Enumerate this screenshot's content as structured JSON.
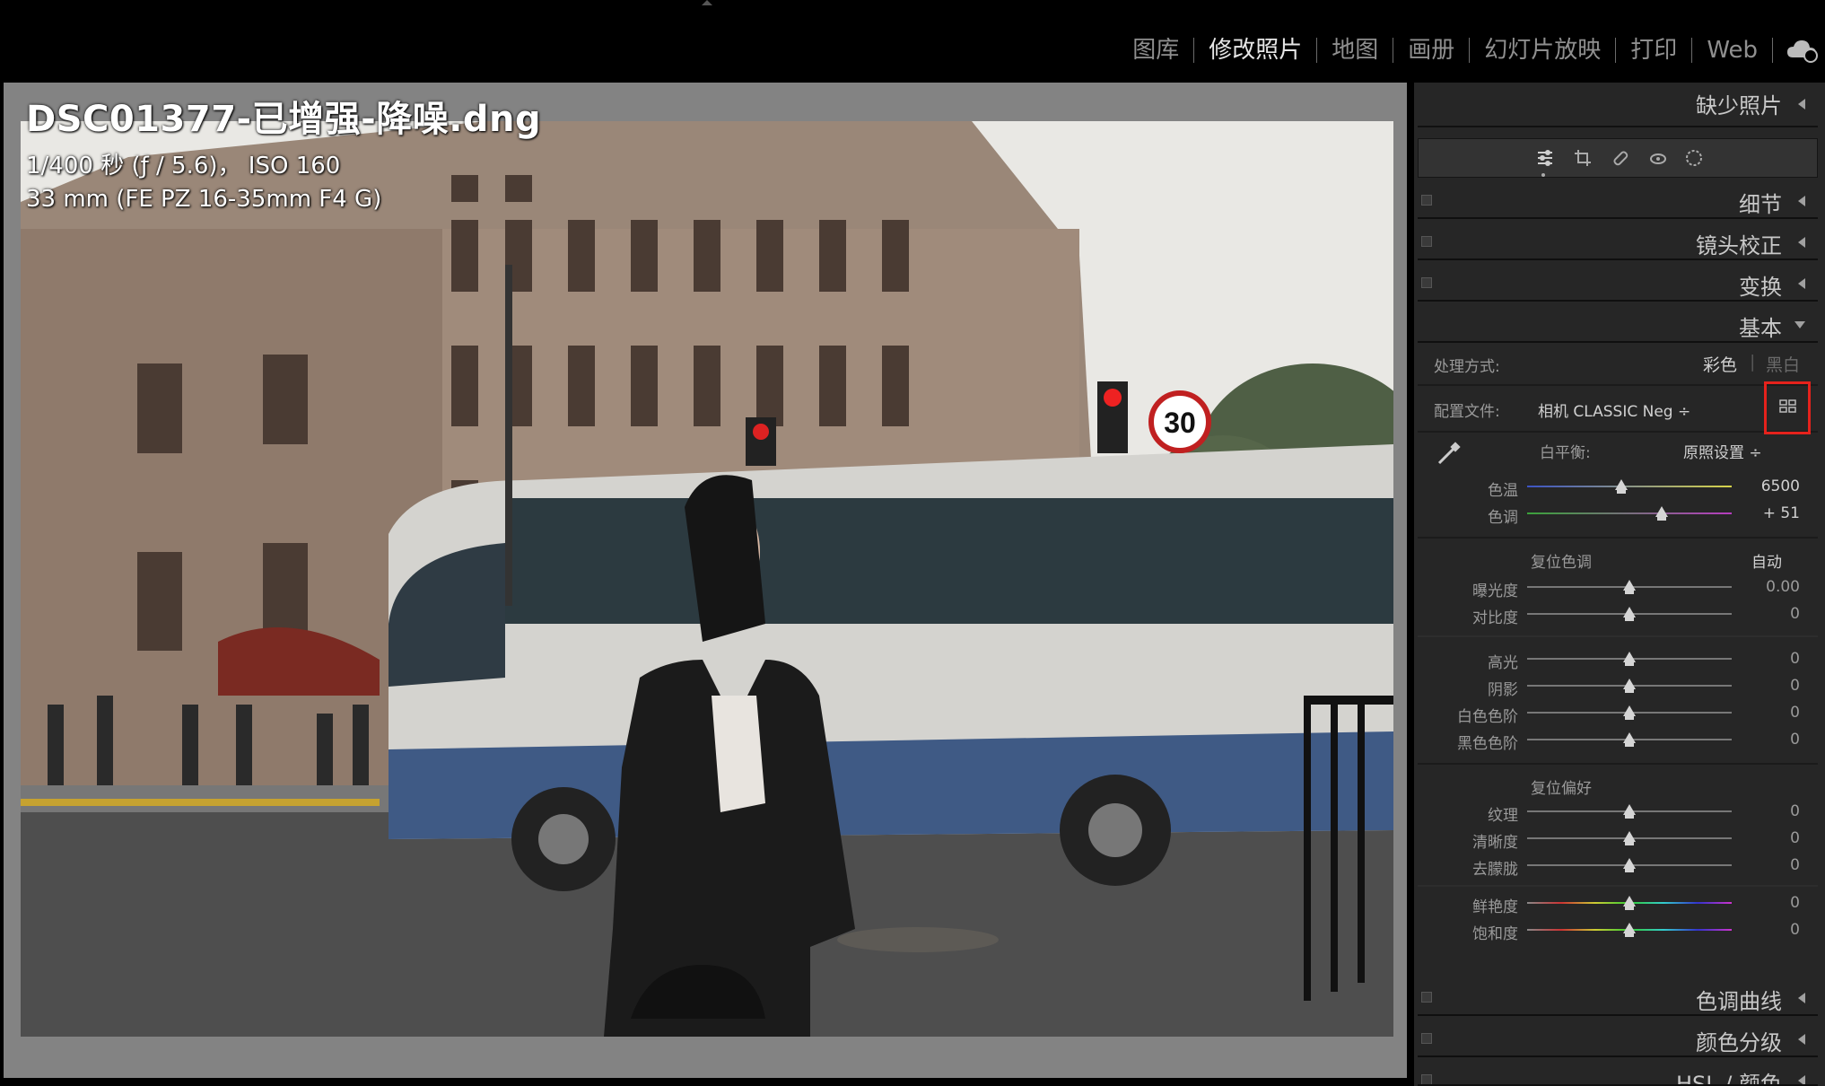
{
  "modules": [
    "图库",
    "修改照片",
    "地图",
    "画册",
    "幻灯片放映",
    "打印",
    "Web"
  ],
  "active_module": "修改照片",
  "photo": {
    "filename": "DSC01377-已增强-降噪.dng",
    "exposure_line": "1/400 秒 (ƒ / 5.6)， ISO 160",
    "lens_line": "33 mm (FE PZ 16-35mm F4 G)",
    "sign_speed": "30"
  },
  "panel": {
    "missing_photo": "缺少照片",
    "sections": {
      "detail": "细节",
      "lens": "镜头校正",
      "transform": "变换",
      "basic": "基本",
      "tone_curve": "色调曲线",
      "color_grading": "颜色分级",
      "hsl": "HSL / 颜色"
    },
    "treatment_label": "处理方式:",
    "treatment_color": "彩色",
    "treatment_bw": "黑白",
    "profile_label": "配置文件:",
    "profile_value": "相机 CLASSIC Neg ÷",
    "wb_label": "白平衡:",
    "wb_value": "原照设置 ÷",
    "temp": {
      "label": "色温",
      "value": "6500",
      "level": 0.46
    },
    "tint": {
      "label": "色调",
      "value": "+ 51",
      "level": 0.66
    },
    "tone_reset": "复位色调",
    "auto": "自动",
    "exposure": {
      "label": "曝光度",
      "value": "0.00",
      "level": 0.5
    },
    "contrast": {
      "label": "对比度",
      "value": "0",
      "level": 0.5
    },
    "highlights": {
      "label": "高光",
      "value": "0",
      "level": 0.5
    },
    "shadows": {
      "label": "阴影",
      "value": "0",
      "level": 0.5
    },
    "whites": {
      "label": "白色色阶",
      "value": "0",
      "level": 0.5
    },
    "blacks": {
      "label": "黑色色阶",
      "value": "0",
      "level": 0.5
    },
    "presence_reset": "复位偏好",
    "texture": {
      "label": "纹理",
      "value": "0",
      "level": 0.5
    },
    "clarity": {
      "label": "清晰度",
      "value": "0",
      "level": 0.5
    },
    "dehaze": {
      "label": "去朦胧",
      "value": "0",
      "level": 0.5
    },
    "vibrance": {
      "label": "鲜艳度",
      "value": "0",
      "level": 0.5
    },
    "saturation": {
      "label": "饱和度",
      "value": "0",
      "level": 0.5
    }
  },
  "colors": {
    "highlight": "#e5221c",
    "panel_bg": "#262626"
  }
}
